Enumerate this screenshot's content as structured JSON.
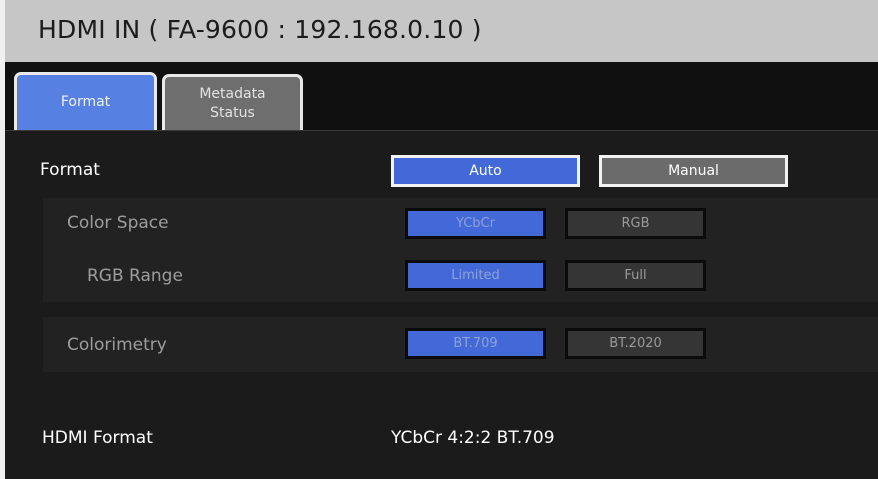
{
  "window": {
    "title": "HDMI IN ( FA-9600 : 192.168.0.10 )"
  },
  "tabs": [
    {
      "label": "Format",
      "active": true
    },
    {
      "label_line1": "Metadata",
      "label_line2": "Status",
      "active": false
    }
  ],
  "format": {
    "label": "Format",
    "auto_label": "Auto",
    "manual_label": "Manual",
    "selected": "Auto"
  },
  "color_space": {
    "label": "Color Space",
    "options": [
      "YCbCr",
      "RGB"
    ],
    "selected": "YCbCr"
  },
  "rgb_range": {
    "label": "RGB Range",
    "options": [
      "Limited",
      "Full"
    ],
    "selected": "Limited"
  },
  "colorimetry": {
    "label": "Colorimetry",
    "options": [
      "BT.709",
      "BT.2020"
    ],
    "selected": "BT.709"
  },
  "hdmi_format": {
    "label": "HDMI Format",
    "value": "YCbCr 4:2:2 BT.709"
  },
  "colors": {
    "accent": "#4368d8",
    "tab_active": "#5680e2",
    "titlebar": "#c6c6c6",
    "background": "#1b1b1b"
  }
}
